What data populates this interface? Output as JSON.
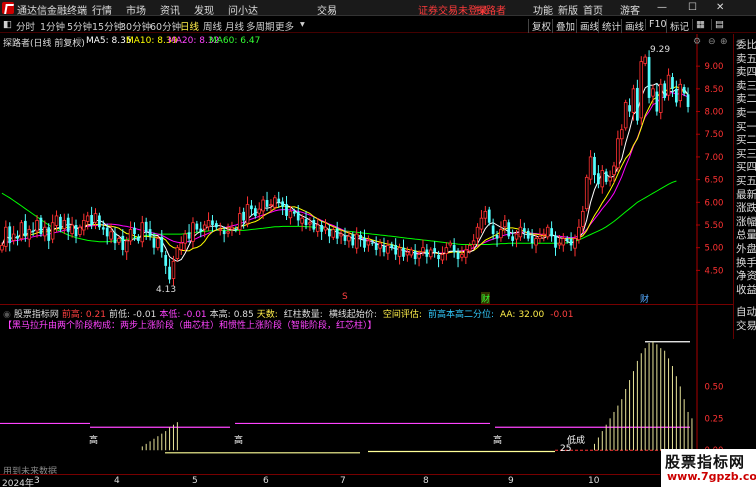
{
  "titlebar": {
    "app_title": "通达信金融终端",
    "menus": [
      "行情",
      "市场",
      "资讯",
      "发现",
      "问小达",
      "交易"
    ],
    "notice_red": "证券交易未登录",
    "notice_red2": "探路者",
    "right_items": [
      "功能",
      "新版",
      "首页",
      "游客"
    ]
  },
  "periodbar": {
    "tabs": [
      "分时",
      "1分钟",
      "5分钟",
      "15分钟",
      "30分钟",
      "60分钟",
      "日线",
      "周线",
      "月线",
      "多周期",
      "更多"
    ],
    "active_tab": "日线",
    "right_buttons": [
      "复权",
      "叠加",
      "画线",
      "统计",
      "画线",
      "F10",
      "标记"
    ]
  },
  "sidebar": {
    "items": [
      "委比",
      "卖五",
      "卖四",
      "卖三",
      "卖二",
      "卖一",
      "买一",
      "买二",
      "买三",
      "买四",
      "买五",
      "最新",
      "涨跌",
      "涨幅",
      "总量",
      "外盘",
      "换手",
      "净资",
      "收益"
    ],
    "lower_items": [
      "自动",
      "交易"
    ]
  },
  "main": {
    "header": "探路者(日线 前复权)",
    "ma5": "MA5: 8.35",
    "ma10": "MA10: 8.39",
    "ma20": "MA20: 8.32",
    "ma60": "MA60: 6.47",
    "high_label": "9.29",
    "low_label": "4.13",
    "marker1": "S",
    "marker2": "财",
    "marker3": "财"
  },
  "indicator": {
    "header": "股票指标网",
    "fields": [
      {
        "label": "前高:",
        "value": "0.21"
      },
      {
        "label": "前低:",
        "value": "-0.01"
      },
      {
        "label": "本低:",
        "value": "-0.01"
      },
      {
        "label": "本高:",
        "value": "0.85"
      },
      {
        "label": "天数:",
        "value": ""
      },
      {
        "label": "红柱数量:",
        "value": ""
      },
      {
        "label": "横线起始价:",
        "value": ""
      },
      {
        "label": "空间评估:",
        "value": ""
      },
      {
        "label": "前高本高二分位:",
        "value": ""
      },
      {
        "label": "AA:",
        "value": "32.00"
      },
      {
        "label": "",
        "value": "-0.01"
      }
    ],
    "description": "【黑马拉升由两个阶段构成：两步上涨阶段（曲芯柱）和惯性上涨阶段（智能阶段，红芯柱）】",
    "gao1": "高",
    "gao2": "高",
    "gao3": "高",
    "dicheng": "低成",
    "num25": "25",
    "footer_left": "用到未来数据"
  },
  "axes": {
    "price_ticks": [
      "9.00",
      "8.50",
      "8.00",
      "7.50",
      "7.00",
      "6.50",
      "6.00",
      "5.50",
      "5.00",
      "4.50"
    ],
    "ind_ticks": [
      "0.50",
      "0.25",
      "0.00"
    ],
    "x_ticks": [
      "2024年",
      "3",
      "4",
      "5",
      "6",
      "7",
      "8",
      "9",
      "10",
      "11"
    ]
  },
  "watermark": {
    "line1": "股票指标网",
    "line2": "www.7gpzb.com"
  },
  "colors": {
    "up": "#ff3232",
    "down": "#54ffff",
    "ma5": "#ffffff",
    "ma10": "#ffff00",
    "ma20": "#ff00ff",
    "ma60": "#00ff00"
  },
  "chart_data": {
    "type": "candlestick",
    "ylim": [
      4.2,
      9.4
    ],
    "closes": [
      5.05,
      5.45,
      5.1,
      5.3,
      5.2,
      5.55,
      5.25,
      5.4,
      5.35,
      5.6,
      5.3,
      5.45,
      5.15,
      5.55,
      5.7,
      5.4,
      5.6,
      5.35,
      5.5,
      5.25,
      5.45,
      5.6,
      5.7,
      5.5,
      5.75,
      5.45,
      5.4,
      5.25,
      5.35,
      5.1,
      5.2,
      4.95,
      5.15,
      5.4,
      5.3,
      5.15,
      5.55,
      5.35,
      5.25,
      5.0,
      5.2,
      4.9,
      4.6,
      4.3,
      4.7,
      5.0,
      5.1,
      5.3,
      5.2,
      5.55,
      5.4,
      5.35,
      5.5,
      5.6,
      5.5,
      5.45,
      5.4,
      5.3,
      5.35,
      5.45,
      5.4,
      5.75,
      5.6,
      5.95,
      5.85,
      5.7,
      5.85,
      6.05,
      5.9,
      5.95,
      6.1,
      6.0,
      5.9,
      5.7,
      5.8,
      5.75,
      5.6,
      5.65,
      5.5,
      5.55,
      5.4,
      5.5,
      5.35,
      5.45,
      5.25,
      5.4,
      5.2,
      5.3,
      5.15,
      5.25,
      5.05,
      5.3,
      5.2,
      5.0,
      5.15,
      5.1,
      4.95,
      5.1,
      4.9,
      5.05,
      5.0,
      4.85,
      5.0,
      4.8,
      4.9,
      4.95,
      4.75,
      4.85,
      5.0,
      4.8,
      4.95,
      4.9,
      4.75,
      4.85,
      5.0,
      5.1,
      4.9,
      4.75,
      4.85,
      4.95,
      5.05,
      5.15,
      5.45,
      5.65,
      5.8,
      5.55,
      5.3,
      5.2,
      5.4,
      5.6,
      5.25,
      5.15,
      5.3,
      5.45,
      5.35,
      5.2,
      5.1,
      5.2,
      5.25,
      5.3,
      5.45,
      5.25,
      5.0,
      5.1,
      5.2,
      5.15,
      5.05,
      5.2,
      5.45,
      5.8,
      6.55,
      7.0,
      6.6,
      6.4,
      6.7,
      6.45,
      6.55,
      6.8,
      7.4,
      7.6,
      8.2,
      8.0,
      8.5,
      7.8,
      9.1,
      9.2,
      8.3,
      8.5,
      8.0,
      8.6,
      8.3,
      8.8,
      8.5,
      8.2,
      8.6,
      8.4,
      8.1
    ],
    "ma20": [
      5.1,
      5.12,
      5.13,
      5.15,
      5.16,
      5.18,
      5.2,
      5.22,
      5.24,
      5.26,
      5.27,
      5.29,
      5.3,
      5.32,
      5.34,
      5.36,
      5.38,
      5.4,
      5.42,
      5.43,
      5.45,
      5.46,
      5.47,
      5.48,
      5.49,
      5.5,
      5.51,
      5.52,
      5.52,
      5.51,
      5.5,
      5.48,
      5.47,
      5.45,
      5.43,
      5.4,
      5.38,
      5.36,
      5.34,
      5.32,
      5.3,
      5.27,
      5.23,
      5.18,
      5.14,
      5.12,
      5.11,
      5.12,
      5.14,
      5.17,
      5.21,
      5.25,
      5.28,
      5.32,
      5.35,
      5.39,
      5.42,
      5.44,
      5.46,
      5.48,
      5.5,
      5.53,
      5.56,
      5.6,
      5.63,
      5.66,
      5.69,
      5.72,
      5.75,
      5.78,
      5.81,
      5.83,
      5.84,
      5.84,
      5.83,
      5.82,
      5.8,
      5.78,
      5.75,
      5.72,
      5.68,
      5.64,
      5.6,
      5.56,
      5.52,
      5.49,
      5.45,
      5.41,
      5.37,
      5.33,
      5.29,
      5.26,
      5.22,
      5.19,
      5.16,
      5.13,
      5.1,
      5.07,
      5.04,
      5.02,
      5.0,
      4.98,
      4.96,
      4.94,
      4.92,
      4.9,
      4.89,
      4.88,
      4.88,
      4.88,
      4.88,
      4.88,
      4.88,
      4.88,
      4.89,
      4.9,
      4.91,
      4.92,
      4.93,
      4.95,
      4.97,
      5.0,
      5.04,
      5.08,
      5.12,
      5.16,
      5.19,
      5.22,
      5.25,
      5.28,
      5.3,
      5.32,
      5.33,
      5.34,
      5.34,
      5.33,
      5.32,
      5.31,
      5.3,
      5.29,
      5.28,
      5.27,
      5.26,
      5.25,
      5.24,
      5.23,
      5.22,
      5.23,
      5.26,
      5.31,
      5.4,
      5.52,
      5.63,
      5.74,
      5.86,
      5.96,
      6.07,
      6.2,
      6.38,
      6.57,
      6.8,
      7.0,
      7.24,
      7.42,
      7.66,
      7.88,
      8.0,
      8.15,
      8.2,
      8.3,
      8.32,
      8.4,
      8.42,
      8.38,
      8.4,
      8.36,
      8.32
    ],
    "ma60": [
      6.2,
      6.15,
      6.1,
      6.04,
      5.98,
      5.92,
      5.86,
      5.8,
      5.74,
      5.68,
      5.62,
      5.56,
      5.5,
      5.45,
      5.4,
      5.36,
      5.32,
      5.28,
      5.25,
      5.22,
      5.2,
      5.18,
      5.16,
      5.15,
      5.14,
      5.13,
      5.13,
      5.13,
      5.14,
      5.15,
      5.16,
      5.17,
      5.18,
      5.2,
      5.22,
      5.24,
      5.26,
      5.27,
      5.28,
      5.29,
      5.3,
      5.3,
      5.3,
      5.3,
      5.3,
      5.3,
      5.3,
      5.31,
      5.32,
      5.33,
      5.34,
      5.35,
      5.36,
      5.37,
      5.37,
      5.38,
      5.38,
      5.38,
      5.38,
      5.38,
      5.38,
      5.38,
      5.38,
      5.39,
      5.4,
      5.41,
      5.42,
      5.43,
      5.44,
      5.45,
      5.46,
      5.46,
      5.47,
      5.47,
      5.47,
      5.47,
      5.47,
      5.47,
      5.46,
      5.46,
      5.45,
      5.44,
      5.43,
      5.42,
      5.41,
      5.4,
      5.39,
      5.38,
      5.37,
      5.36,
      5.35,
      5.34,
      5.33,
      5.32,
      5.31,
      5.3,
      5.29,
      5.28,
      5.27,
      5.26,
      5.25,
      5.24,
      5.23,
      5.22,
      5.21,
      5.2,
      5.19,
      5.18,
      5.17,
      5.16,
      5.15,
      5.14,
      5.13,
      5.12,
      5.11,
      5.1,
      5.09,
      5.08,
      5.07,
      5.07,
      5.07,
      5.07,
      5.07,
      5.07,
      5.07,
      5.07,
      5.08,
      5.08,
      5.09,
      5.09,
      5.1,
      5.1,
      5.1,
      5.1,
      5.1,
      5.1,
      5.1,
      5.1,
      5.1,
      5.1,
      5.1,
      5.1,
      5.1,
      5.1,
      5.1,
      5.11,
      5.12,
      5.14,
      5.17,
      5.21,
      5.25,
      5.29,
      5.33,
      5.37,
      5.41,
      5.46,
      5.52,
      5.58,
      5.65,
      5.72,
      5.79,
      5.86,
      5.93,
      6.0,
      6.05,
      6.1,
      6.15,
      6.2,
      6.25,
      6.3,
      6.35,
      6.4,
      6.44,
      6.47
    ],
    "ind_bars": [
      0,
      0,
      0,
      0,
      0,
      0,
      0,
      0,
      0,
      0,
      0,
      0,
      0,
      0,
      0,
      0,
      0,
      0,
      0,
      0,
      0,
      0,
      0,
      0,
      0,
      0,
      0,
      0,
      0,
      0,
      0,
      0,
      0,
      0,
      0,
      0,
      0.03,
      0.05,
      0.07,
      0.09,
      0.11,
      0.13,
      0.15,
      0.18,
      0.2,
      0.22,
      0,
      0,
      0,
      0,
      0,
      0,
      0,
      0,
      0,
      0,
      0,
      0,
      0,
      0,
      0,
      0,
      0,
      0,
      0,
      0,
      0,
      0,
      0,
      0,
      0,
      0,
      0,
      0,
      0,
      0,
      0,
      0,
      0,
      0,
      0,
      0,
      0,
      0,
      0,
      0,
      0,
      0,
      0,
      0,
      0,
      0,
      0,
      0,
      0,
      0,
      0,
      0,
      0,
      0,
      0,
      0,
      0,
      0,
      0,
      0,
      0,
      0,
      0,
      0,
      0,
      0,
      0,
      0,
      0,
      0,
      0,
      0,
      0,
      0,
      0,
      0,
      0,
      0,
      0,
      0,
      0,
      0,
      0,
      0,
      0,
      0,
      0,
      0,
      0,
      0,
      0,
      0,
      0,
      0,
      0,
      0,
      0,
      0,
      0,
      0,
      0,
      0,
      0,
      0,
      0,
      0,
      0.05,
      0.1,
      0.15,
      0.2,
      0.25,
      0.3,
      0.35,
      0.4,
      0.48,
      0.55,
      0.62,
      0.7,
      0.76,
      0.8,
      0.84,
      0.85,
      0.83,
      0.8,
      0.78,
      0.72,
      0.66,
      0.58,
      0.5,
      0.4,
      0.3,
      0.25
    ],
    "ind_ylim": [
      -0.1,
      0.95
    ]
  }
}
